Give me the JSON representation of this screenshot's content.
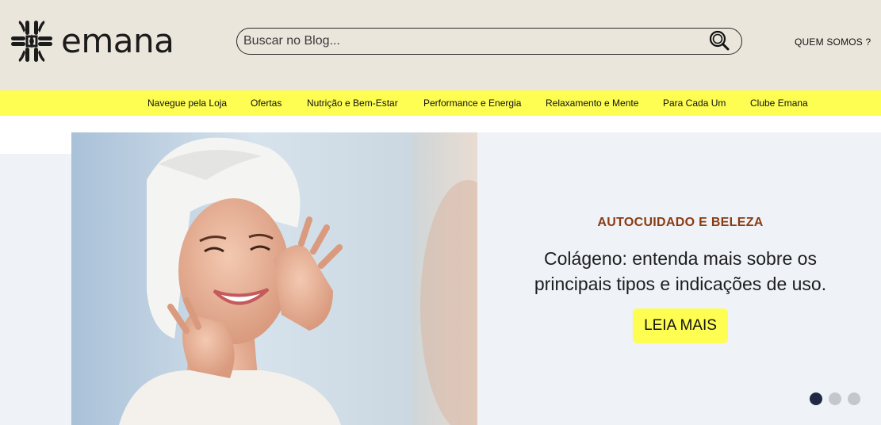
{
  "brand": {
    "name": "emana"
  },
  "search": {
    "placeholder": "Buscar no Blog...",
    "icon": "search-icon"
  },
  "header": {
    "about_label": "QUEM SOMOS ?"
  },
  "nav": {
    "items": [
      {
        "label": "Navegue pela Loja"
      },
      {
        "label": "Ofertas"
      },
      {
        "label": "Nutrição e Bem-Estar"
      },
      {
        "label": "Performance e Energia"
      },
      {
        "label": "Relaxamento e Mente"
      },
      {
        "label": "Para Cada Um"
      },
      {
        "label": "Clube Emana"
      }
    ]
  },
  "hero": {
    "category": "AUTOCUIDADO E BELEZA",
    "title": "Colágeno: entenda mais sobre os principais tipos e indicações de uso.",
    "cta_label": "LEIA MAIS",
    "slides": {
      "count": 3,
      "active": 1
    }
  },
  "colors": {
    "header_bg": "#ebe6dc",
    "nav_bg": "#fdfd52",
    "accent_yellow": "#fdfd52",
    "category_brown": "#8a3b12",
    "hero_bg": "#eff2f7",
    "dot_active": "#1e2a44",
    "dot_inactive": "#c4c7cc"
  }
}
